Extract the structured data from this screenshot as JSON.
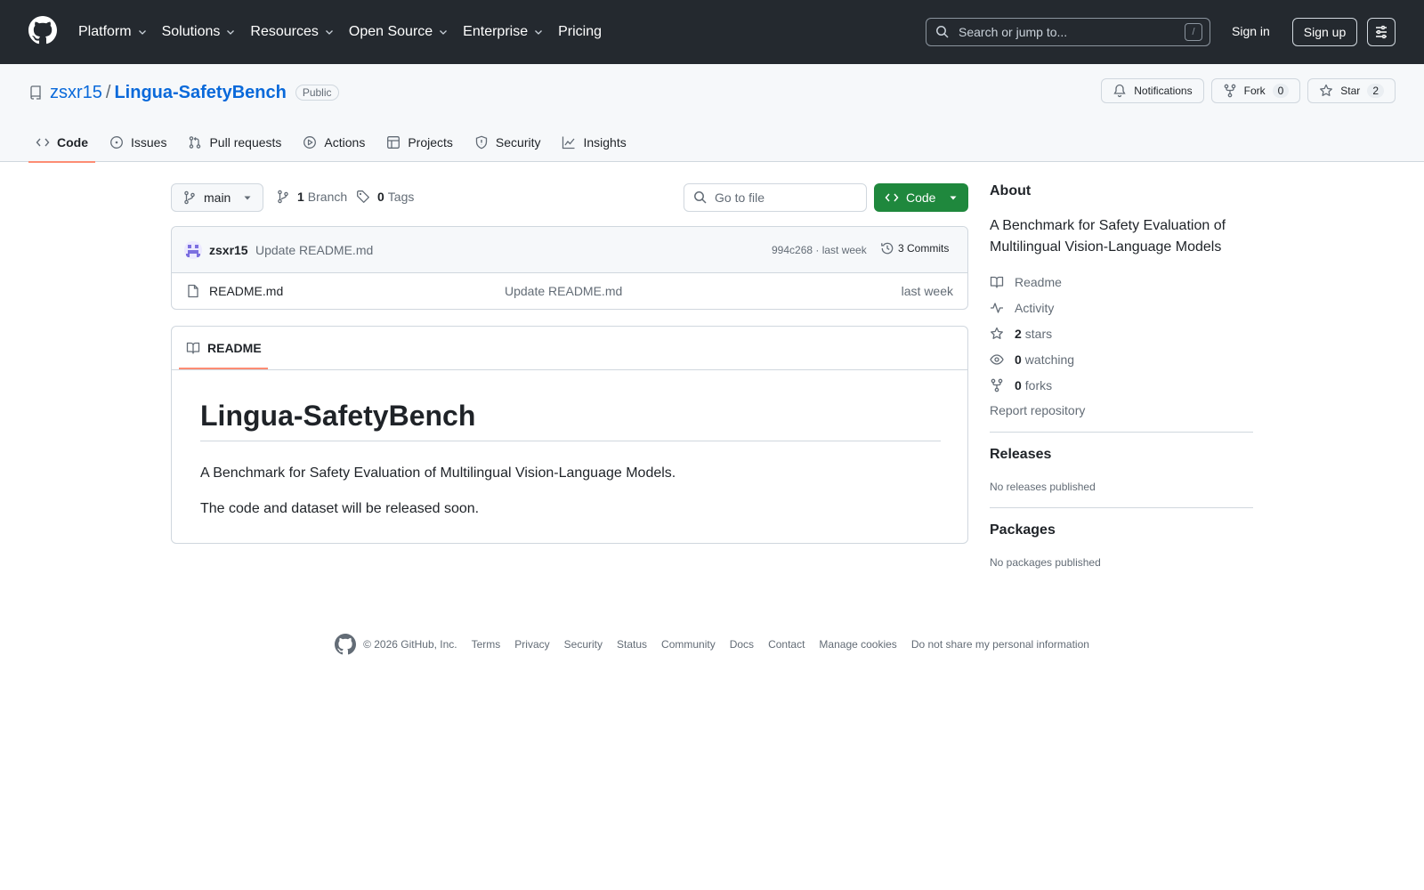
{
  "header": {
    "nav": [
      {
        "label": "Platform",
        "dropdown": true
      },
      {
        "label": "Solutions",
        "dropdown": true
      },
      {
        "label": "Resources",
        "dropdown": true
      },
      {
        "label": "Open Source",
        "dropdown": true
      },
      {
        "label": "Enterprise",
        "dropdown": true
      },
      {
        "label": "Pricing",
        "dropdown": false
      }
    ],
    "search_placeholder": "Search or jump to...",
    "search_shortcut": "/",
    "signin": "Sign in",
    "signup": "Sign up"
  },
  "repo": {
    "owner": "zsxr15",
    "separator": "/",
    "name": "Lingua-SafetyBench",
    "visibility": "Public",
    "notifications": "Notifications",
    "fork_label": "Fork",
    "fork_count": "0",
    "star_label": "Star",
    "star_count": "2",
    "tabs": [
      {
        "label": "Code",
        "icon": "code-icon",
        "active": true
      },
      {
        "label": "Issues",
        "icon": "issue-icon",
        "active": false
      },
      {
        "label": "Pull requests",
        "icon": "pull-request-icon",
        "active": false
      },
      {
        "label": "Actions",
        "icon": "play-icon",
        "active": false
      },
      {
        "label": "Projects",
        "icon": "table-icon",
        "active": false
      },
      {
        "label": "Security",
        "icon": "shield-icon",
        "active": false
      },
      {
        "label": "Insights",
        "icon": "graph-icon",
        "active": false
      }
    ]
  },
  "toolbar": {
    "branch": "main",
    "branch_count": "1",
    "branch_label": "Branch",
    "tag_count": "0",
    "tag_label": "Tags",
    "go_to_file": "Go to file",
    "code_button": "Code"
  },
  "commit": {
    "author": "zsxr15",
    "message": "Update README.md",
    "hash_time": "994c268 · last week",
    "commits": "3 Commits"
  },
  "files": [
    {
      "name": "README.md",
      "message": "Update README.md",
      "date": "last week"
    }
  ],
  "readme": {
    "tab": "README",
    "title": "Lingua-SafetyBench",
    "p1": "A Benchmark for Safety Evaluation of Multilingual Vision-Language Models.",
    "p2": "The code and dataset will be released soon."
  },
  "sidebar": {
    "about_title": "About",
    "about_desc": "A Benchmark for Safety Evaluation of Multilingual Vision-Language Models",
    "readme": "Readme",
    "activity": "Activity",
    "stars_count": "2",
    "stars_label": "stars",
    "watching_count": "0",
    "watching_label": "watching",
    "forks_count": "0",
    "forks_label": "forks",
    "report": "Report repository",
    "releases_title": "Releases",
    "releases_none": "No releases published",
    "packages_title": "Packages",
    "packages_none": "No packages published"
  },
  "footer": {
    "copyright": "© 2026 GitHub, Inc.",
    "links": [
      "Terms",
      "Privacy",
      "Security",
      "Status",
      "Community",
      "Docs",
      "Contact",
      "Manage cookies",
      "Do not share my personal information"
    ]
  },
  "colors": {
    "header_bg": "#24292f",
    "link": "#0969da",
    "accent_green": "#1f883d",
    "tab_underline": "#fd8c73"
  }
}
